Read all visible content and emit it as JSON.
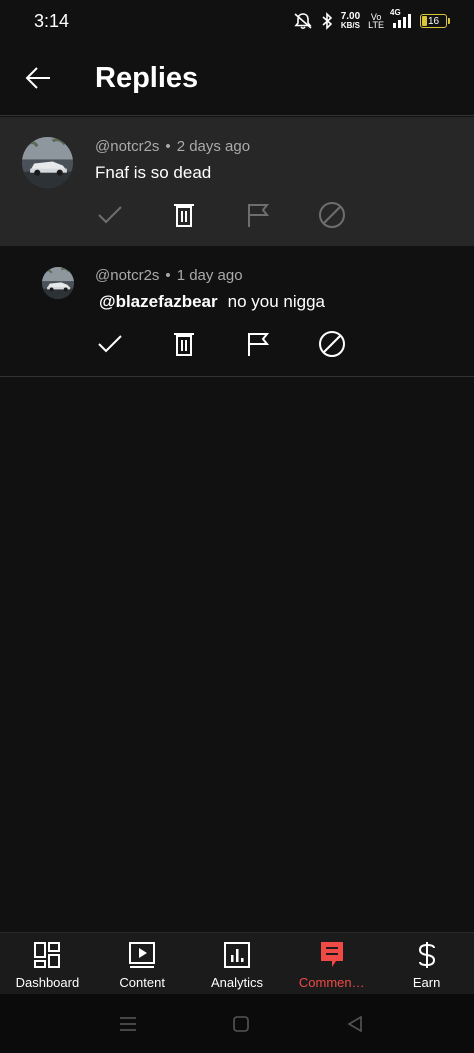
{
  "status_bar": {
    "time": "3:14",
    "net_speed_value": "7.00",
    "net_speed_unit": "KB/S",
    "volte_top": "Vo",
    "volte_bottom": "LTE",
    "network": "4G",
    "battery": "16",
    "icons": [
      "mute-icon",
      "bluetooth-icon",
      "signal-icon",
      "battery-icon"
    ]
  },
  "header": {
    "back_icon": "arrow-left-icon",
    "title": "Replies"
  },
  "parent_comment": {
    "author": "@notcr2s",
    "separator": "•",
    "time_ago": "2 days ago",
    "text": "Fnaf is so dead",
    "actions": [
      "approve-icon",
      "delete-icon",
      "report-icon",
      "block-icon"
    ]
  },
  "reply_comment": {
    "author": "@notcr2s",
    "separator": "•",
    "time_ago": "1 day ago",
    "mention": "@blazefazbear",
    "text": "no you nigga",
    "actions": [
      "approve-icon",
      "delete-icon",
      "report-icon",
      "block-icon"
    ]
  },
  "bottom_nav": {
    "items": [
      {
        "label": "Dashboard",
        "icon": "dashboard-icon"
      },
      {
        "label": "Content",
        "icon": "content-icon"
      },
      {
        "label": "Analytics",
        "icon": "analytics-icon"
      },
      {
        "label": "Commen…",
        "icon": "comments-icon",
        "active": true
      },
      {
        "label": "Earn",
        "icon": "dollar-icon"
      }
    ]
  },
  "system_nav": {
    "icons": [
      "recents-icon",
      "home-icon",
      "back-icon"
    ]
  },
  "colors": {
    "background": "#111111",
    "highlight_row": "#272727",
    "accent": "#f04a46",
    "muted_text": "#aaaaaa",
    "disabled_icon": "#6e6e6e",
    "battery": "#d8c63a"
  }
}
